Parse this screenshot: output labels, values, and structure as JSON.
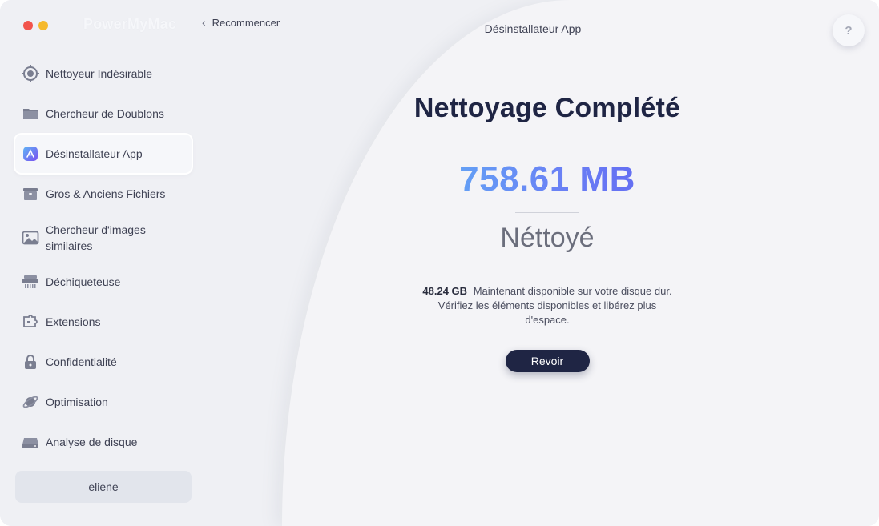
{
  "app": {
    "brand": "PowerMyMac",
    "window_title": "Désinstallateur App"
  },
  "header": {
    "back_label": "Recommencer",
    "help_label": "?"
  },
  "sidebar": {
    "items": [
      {
        "id": "junk",
        "label": "Nettoyeur Indésirable",
        "icon": "target-icon"
      },
      {
        "id": "duplicates",
        "label": "Chercheur de Doublons",
        "icon": "folder-icon"
      },
      {
        "id": "uninstaller",
        "label": "Désinstallateur App",
        "icon": "app-store-icon",
        "active": true
      },
      {
        "id": "large-files",
        "label": "Gros & Anciens Fichiers",
        "icon": "archive-box-icon"
      },
      {
        "id": "similar-images",
        "label": "Chercheur d'images similaires",
        "icon": "image-icon"
      },
      {
        "id": "shredder",
        "label": "Déchiqueteuse",
        "icon": "shredder-icon"
      },
      {
        "id": "extensions",
        "label": "Extensions",
        "icon": "puzzle-icon"
      },
      {
        "id": "privacy",
        "label": "Confidentialité",
        "icon": "lock-icon"
      },
      {
        "id": "optimization",
        "label": "Optimisation",
        "icon": "planet-icon"
      },
      {
        "id": "disk-analysis",
        "label": "Analyse de disque",
        "icon": "hard-drive-icon"
      }
    ],
    "user": "eliene"
  },
  "result": {
    "heading": "Nettoyage Complété",
    "amount": "758.61 MB",
    "status": "Néttoyé",
    "available_size": "48.24 GB",
    "description": "Maintenant disponible sur votre disque dur. Vérifiez les éléments disponibles et libérez plus d'espace.",
    "review_button": "Revoir"
  },
  "colors": {
    "accent_dark": "#1f2544",
    "gradient_start": "#5fb5f5",
    "gradient_end": "#5e5ef0",
    "traffic_red": "#f2544c",
    "traffic_yellow": "#f5b92c"
  }
}
